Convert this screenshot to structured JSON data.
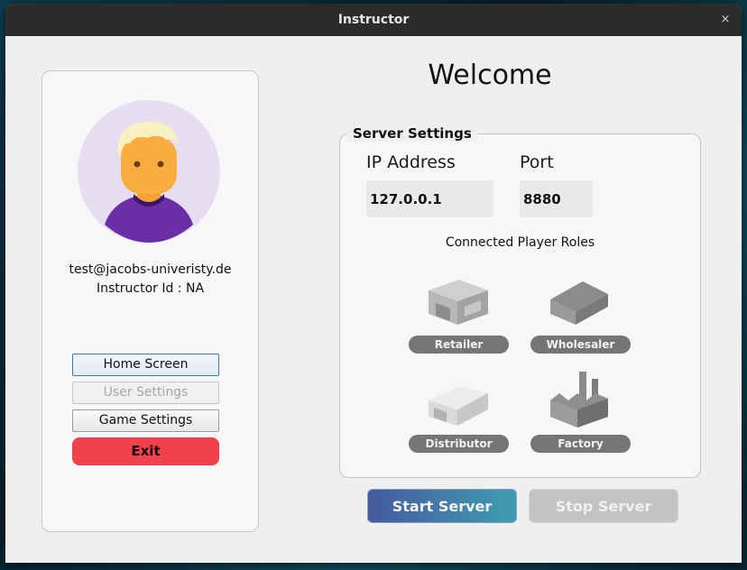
{
  "window": {
    "title": "Instructor",
    "close_glyph": "×"
  },
  "profile": {
    "email": "test@jacobs-univeristy.de",
    "instructor_id": "Instructor Id :   NA",
    "avatar_icon": "user-avatar-icon"
  },
  "nav": {
    "home_label": "Home Screen",
    "user_settings_label": "User Settings",
    "game_settings_label": "Game Settings",
    "exit_label": "Exit"
  },
  "main": {
    "welcome": "Welcome",
    "server_settings_title": "Server Settings",
    "ip_label": "IP Address",
    "ip_value": "127.0.0.1",
    "port_label": "Port",
    "port_value": "8880",
    "roles_title": "Connected Player Roles",
    "roles": [
      {
        "label": "Retailer",
        "icon": "retailer-building-icon"
      },
      {
        "label": "Wholesaler",
        "icon": "wholesaler-building-icon"
      },
      {
        "label": "Distributor",
        "icon": "distributor-building-icon"
      },
      {
        "label": "Factory",
        "icon": "factory-building-icon"
      }
    ],
    "start_label": "Start Server",
    "stop_label": "Stop Server"
  },
  "colors": {
    "exit": "#f0414f",
    "role_badge": "#757575",
    "start_gradient_from": "#455a9e",
    "start_gradient_to": "#3f9db0",
    "stop_disabled": "#c3c3c3"
  }
}
